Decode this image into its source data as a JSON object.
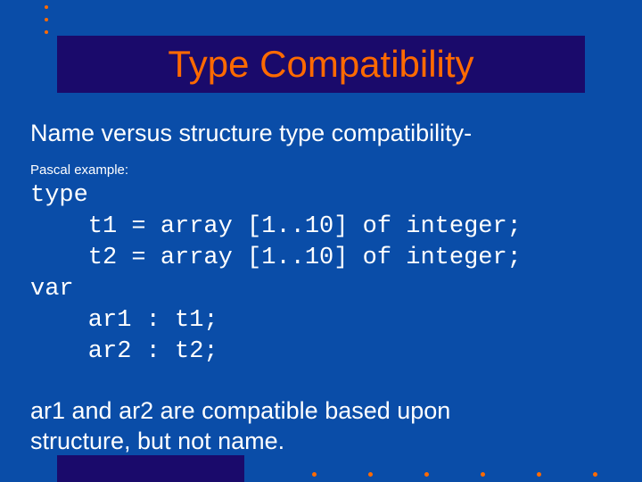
{
  "title": "Type Compatibility",
  "subtitle": "Name versus structure type compatibility-",
  "pascal_label": "Pascal example:",
  "code": "type\n    t1 = array [1..10] of integer;\n    t2 = array [1..10] of integer;\nvar\n    ar1 : t1;\n    ar2 : t2;",
  "footnote1": "ar1 and ar2 are compatible based upon",
  "footnote2": "structure, but not name."
}
